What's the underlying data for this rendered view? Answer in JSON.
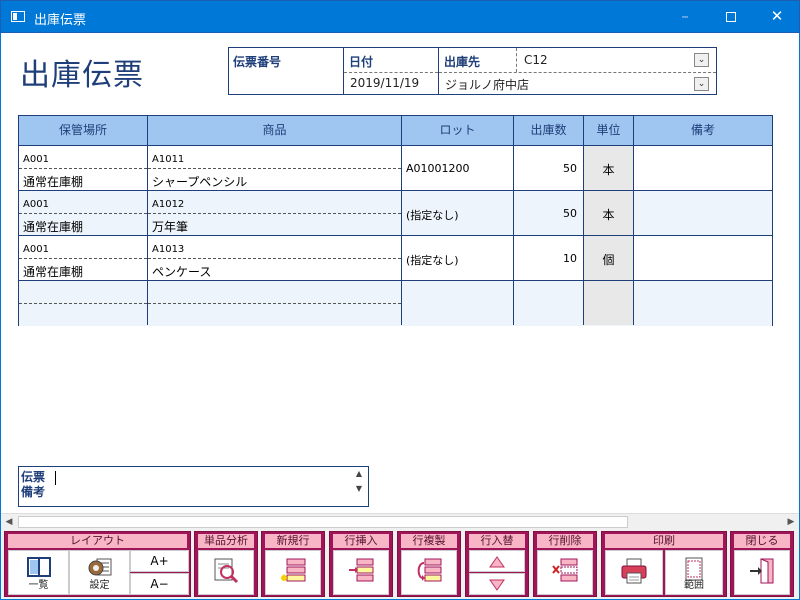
{
  "window": {
    "title": "出庫伝票"
  },
  "page": {
    "title": "出庫伝票"
  },
  "header": {
    "voucher_no_label": "伝票番号",
    "voucher_no_value": "",
    "date_label": "日付",
    "date_value": "2019/11/19",
    "dest_label": "出庫先",
    "dest_code": "C12",
    "dest_name": "ジョルノ府中店"
  },
  "grid": {
    "columns": [
      "保管場所",
      "商品",
      "ロット",
      "出庫数",
      "単位",
      "備考"
    ],
    "rows": [
      {
        "loc_code": "A001",
        "loc_name": "通常在庫棚",
        "item_code": "A1011",
        "item_name": "シャープペンシル",
        "lot": "A01001200",
        "qty": "50",
        "unit": "本",
        "note": ""
      },
      {
        "loc_code": "A001",
        "loc_name": "通常在庫棚",
        "item_code": "A1012",
        "item_name": "万年筆",
        "lot": "(指定なし)",
        "qty": "50",
        "unit": "本",
        "note": ""
      },
      {
        "loc_code": "A001",
        "loc_name": "通常在庫棚",
        "item_code": "A1013",
        "item_name": "ペンケース",
        "lot": "(指定なし)",
        "qty": "10",
        "unit": "個",
        "note": ""
      },
      {
        "loc_code": "",
        "loc_name": "",
        "item_code": "",
        "item_name": "",
        "lot": "",
        "qty": "",
        "unit": "",
        "note": ""
      }
    ]
  },
  "memo": {
    "label_line1": "伝票",
    "label_line2": "備考",
    "value": ""
  },
  "toolbar": {
    "layout_title": "レイアウト",
    "list_label": "一覧",
    "settings_label": "設定",
    "font_up_label": "A+",
    "font_down_label": "A−",
    "analysis_title": "単品分析",
    "new_row_title": "新規行",
    "insert_row_title": "行挿入",
    "copy_row_title": "行複製",
    "swap_row_title": "行入替",
    "delete_row_title": "行削除",
    "print_title": "印刷",
    "range_label": "範囲",
    "close_title": "閉じる"
  },
  "colors": {
    "accent": "#1f3f7a",
    "header_bg": "#9fc6f0",
    "toolbar_group": "#a0155a",
    "toolbar_title": "#f7b5c5",
    "titlebar": "#0078d7"
  }
}
